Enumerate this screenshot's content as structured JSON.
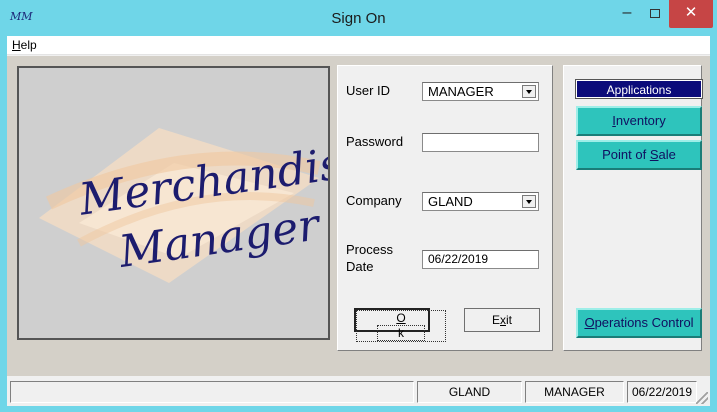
{
  "window": {
    "title": "Sign On",
    "app_icon_text": "MM",
    "minimize_label": "–",
    "close_label": "✕"
  },
  "menu": {
    "help_prefix": "",
    "help_hotkey": "H",
    "help_rest": "elp"
  },
  "logo": {
    "line1": "Merchandise",
    "line2": "Manager"
  },
  "form": {
    "user_id_label": "User ID",
    "user_id_value": "MANAGER",
    "password_label": "Password",
    "password_value": "",
    "company_label": "Company",
    "company_value": "GLAND",
    "process_date_label_1": "Process",
    "process_date_label_2": "Date",
    "process_date_value": "06/22/2019",
    "ok_hotkey": "O",
    "ok_rest": "k",
    "exit_prefix": "E",
    "exit_hotkey": "x",
    "exit_rest": "it"
  },
  "applications": {
    "header": "Applications",
    "inventory_hotkey": "I",
    "inventory_rest": "nventory",
    "pos_prefix": "Point of ",
    "pos_hotkey": "S",
    "pos_rest": "ale",
    "ops_hotkey": "O",
    "ops_rest": "perations Control",
    "accent_color": "#2ec4bc",
    "header_color": "#0b0b7a"
  },
  "status": {
    "cell1": "",
    "company": "GLAND",
    "user": "MANAGER",
    "date": "06/22/2019"
  }
}
